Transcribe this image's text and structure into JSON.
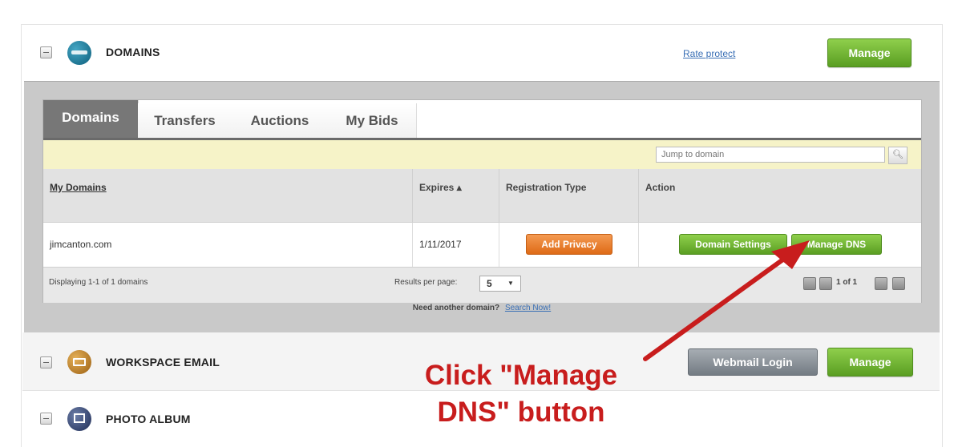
{
  "domains_section": {
    "title": "DOMAINS",
    "link": "Rate protect",
    "manage_label": "Manage"
  },
  "tabs": [
    {
      "label": "Domains",
      "active": true
    },
    {
      "label": "Transfers",
      "active": false
    },
    {
      "label": "Auctions",
      "active": false
    },
    {
      "label": "My Bids",
      "active": false
    }
  ],
  "search": {
    "placeholder": "Jump to domain",
    "icon": "magnifier-icon"
  },
  "table": {
    "columns": [
      "My Domains",
      "Expires ▴",
      "Registration Type",
      "Action"
    ],
    "rows": [
      {
        "domain": "jimcanton.com",
        "expires": "1/11/2017",
        "registration_button": "Add Privacy",
        "actions": [
          "Domain Settings",
          "Manage DNS"
        ]
      }
    ]
  },
  "footer": {
    "displaying": "Displaying 1-1 of 1 domains",
    "results_label": "Results per page:",
    "results_value": "5",
    "page_info": "1 of 1"
  },
  "need_domain": {
    "text": "Need another domain?",
    "link": "Search Now!"
  },
  "workspace_section": {
    "title": "WORKSPACE EMAIL",
    "webmail_label": "Webmail Login",
    "manage_label": "Manage"
  },
  "photo_section": {
    "title": "PHOTO ALBUM"
  },
  "annotation": {
    "line1": "Click \"Manage",
    "line2": "DNS\" button"
  },
  "colors": {
    "accent_green": "#6bb02d",
    "accent_orange": "#e8772a",
    "annotation_red": "#c81d1d",
    "panel_grey": "#c9c9c9"
  }
}
